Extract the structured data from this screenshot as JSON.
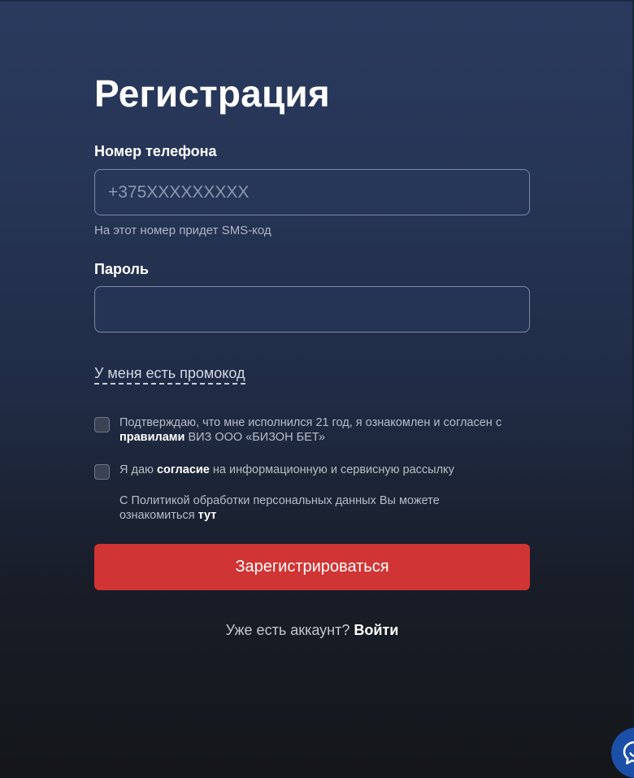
{
  "form": {
    "title": "Регистрация",
    "phone": {
      "label": "Номер телефона",
      "placeholder": "+375XXXXXXXXX",
      "value": "",
      "hint": "На этот номер придет SMS-код"
    },
    "password": {
      "label": "Пароль",
      "value": ""
    },
    "promo_link": "У меня есть промокод",
    "consents": [
      {
        "checked": false,
        "text_before": "Подтверждаю, что мне исполнился 21 год, я ознакомлен и согласен с",
        "link": "правилами",
        "text_after": "ВИЗ ООО «БИЗОН БЕТ»"
      },
      {
        "checked": false,
        "text_before": "Я даю",
        "link": "согласие",
        "text_after": "на информационную и сервисную рассылку"
      }
    ],
    "privacy_note": {
      "text": "С Политикой обработки персональных данных Вы можете ознакомиться",
      "link": "тут"
    },
    "submit_label": "Зарегистрироваться",
    "login_prompt": "Уже есть аккаунт?",
    "login_link": "Войти"
  },
  "chat_widget": {
    "icon": "chat-bubble-icon"
  },
  "colors": {
    "accent": "#d13434",
    "chat": "#1b4fa8",
    "background_top": "#2a3a5e",
    "background_bottom": "#141619"
  }
}
